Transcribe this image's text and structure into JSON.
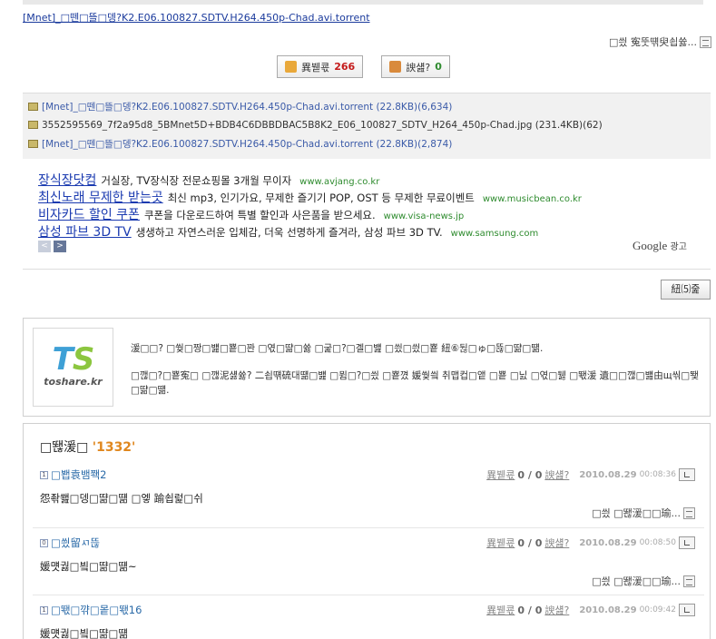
{
  "header": {
    "torrent_link": "[Mnet]_□뗀□뜰□뎅?K2.E06.100827.SDTV.H264.450p-Chad.avi.torrent",
    "report_label": "□씠 寃뚯떆臾쇱쓣..."
  },
  "votes": {
    "up_label": "異붿쿇",
    "up_count": "266",
    "down_label": "諛섎?",
    "down_count": "0"
  },
  "files": [
    {
      "name": "[Mnet]_□뗀□뜰□뎅?K2.E06.100827.SDTV.H264.450p-Chad.avi.torrent (22.8KB)(6,634)",
      "link": true
    },
    {
      "name": "3552595569_7f2a95d8_5BMnet5D+BDB4C6DBBDBAC5B8K2_E06_100827_SDTV_H264_450p-Chad.jpg (231.4KB)(62)",
      "link": false
    },
    {
      "name": "[Mnet]_□뗀□뜰□뎅?K2.E06.100827.SDTV.H264.450p-Chad.avi.torrent (22.8KB)(2,874)",
      "link": true
    }
  ],
  "ads": [
    {
      "title": "장식장닷컴",
      "desc": "거실장, TV장식장 전문쇼핑몰 3개월 무이자",
      "url": "www.avjang.co.kr"
    },
    {
      "title": "최신노래 무제한 받는곳",
      "desc": "최신 mp3, 인기가요, 무제한 즐기기 POP, OST 등 무제한 무료이벤트",
      "url": "www.musicbean.co.kr"
    },
    {
      "title": "비자카드 할인 쿠폰",
      "desc": "쿠폰을 다운로드하여 특별 할인과 사은품을 받으세요.",
      "url": "www.visa-news.jp"
    },
    {
      "title": "삼성 파브 3D TV",
      "desc": "생생하고 자연스러운 입체감, 더욱 선명하게 즐겨라, 삼성 파브 3D TV.",
      "url": "www.samsung.com"
    }
  ],
  "ad_nav": {
    "prev": "<",
    "next": ">"
  },
  "google_ads": {
    "brand": "Google",
    "suffix": "광고"
  },
  "list_button": "紐⑸줉",
  "promo": {
    "logo_letters_t": "T",
    "logo_letters_s": "S",
    "logo_domain": "toshare.kr",
    "text1": "湲□□? □쒖□짱□뱶□뿉□꽌 □엯□땲□쓣 □굹□?□곌□뱶 □씠□씠□뿉 紐⑥뒪□ゅ□뜒□땲□떎.",
    "text2": "□깮□?□뿉寃□ □깮泥섏쓣? 二쇱떆硫대떎□뱶 □뮘□?□씠 □뿉꼈 媛쒖씤 취맵컵□앹 □뿉 □닔 □엯□뒗 □뙋湲 遺□□깮□뱶由щ씪□뙟□땲□떎."
  },
  "comments_header": {
    "label": "□뙎湲□",
    "count": "'1332'"
  },
  "comments": [
    {
      "level": "1",
      "author": "□봽袁뱀쫵2",
      "body": "怨좎쐞□뎅□땲□떎 □엫 踰쇱럹□쉬",
      "rec": "異붿쿇",
      "score": "0 / 0",
      "against": "諛섎?",
      "date": "2010.08.29",
      "time": "00:08:36",
      "report": "□씠 □뙎湲□□瑜..."
    },
    {
      "level": "0",
      "author": "□씠留ㅺ뜮",
      "body": "媛먯궗□빀□땲□떎~",
      "rec": "異붿쿇",
      "score": "0 / 0",
      "against": "諛섎?",
      "date": "2010.08.29",
      "time": "00:08:50",
      "report": "□씠 □뙎湲□□瑜..."
    },
    {
      "level": "1",
      "author": "□뙋□꺆□뫁□뙋16",
      "body": "媛먯궗□빀□땲□떎",
      "rec": "異붿쿇",
      "score": "0 / 0",
      "against": "諛섎?",
      "date": "2010.08.29",
      "time": "00:09:42",
      "report": ""
    }
  ]
}
